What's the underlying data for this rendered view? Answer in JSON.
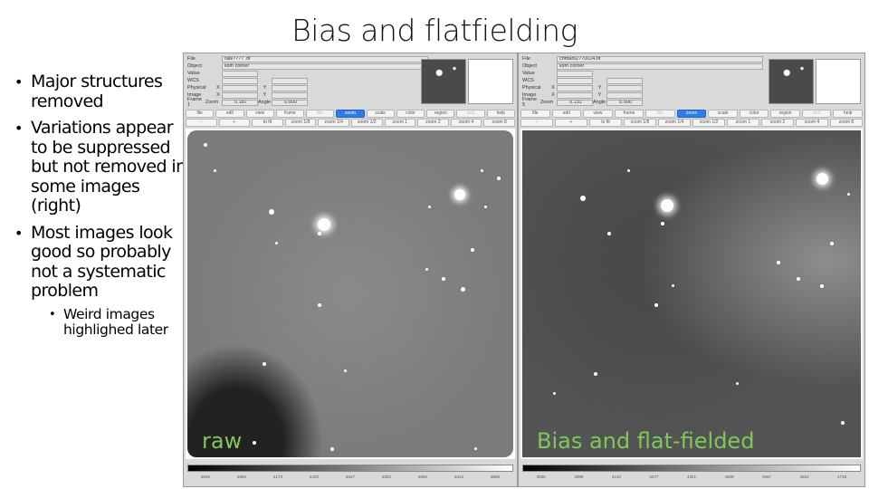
{
  "slide": {
    "title": "Bias and flatfielding",
    "bullets": [
      "Major structures removed",
      "Variations appear to be suppressed but not removed in some images (right)",
      "Most images look good so probably not a systematic problem"
    ],
    "sub_bullets": [
      "Weird images highlighed later"
    ]
  },
  "panels": [
    {
      "file": "raw???? .fit",
      "object": "ksm corner",
      "frame": "Frame 1",
      "zoom": "0.187",
      "angle": "0.000",
      "caption": "raw",
      "colorbar_ticks": [
        "3916",
        "4084",
        "4173",
        "4420",
        "4647",
        "4822",
        "5050",
        "3414",
        "3506"
      ]
    },
    {
      "file": "cnfbars2??0014.fit",
      "object": "ksm corner",
      "frame": "Frame 5",
      "zoom": "0.131",
      "angle": "0.000",
      "caption": "Bias and flat-fielded",
      "colorbar_ticks": [
        "3936",
        "4089",
        "4142",
        "4277",
        "4321",
        "4409",
        "4567",
        "4624",
        "4718"
      ]
    }
  ],
  "labels": {
    "file": "File",
    "object": "Object",
    "value": "Value",
    "wcs": "WCS",
    "physical": "Physical",
    "image": "Image",
    "x": "X",
    "y": "Y",
    "zoom": "Zoom",
    "angle": "Angle"
  },
  "menu_buttons": [
    "file",
    "edit",
    "view",
    "frame",
    "bin",
    "zoom",
    "scale",
    "color",
    "region",
    "wcs",
    "help"
  ],
  "zoom_buttons": [
    "-",
    "+",
    "to fit",
    "zoom 1/8",
    "zoom 1/4",
    "zoom 1/2",
    "zoom 1",
    "zoom 2",
    "zoom 4",
    "zoom 8"
  ],
  "active_menu": "zoom",
  "disabled_menus": [
    "bin",
    "wcs"
  ],
  "colors": {
    "caption": "#7ec85a",
    "active_button": "#2f7be9"
  }
}
